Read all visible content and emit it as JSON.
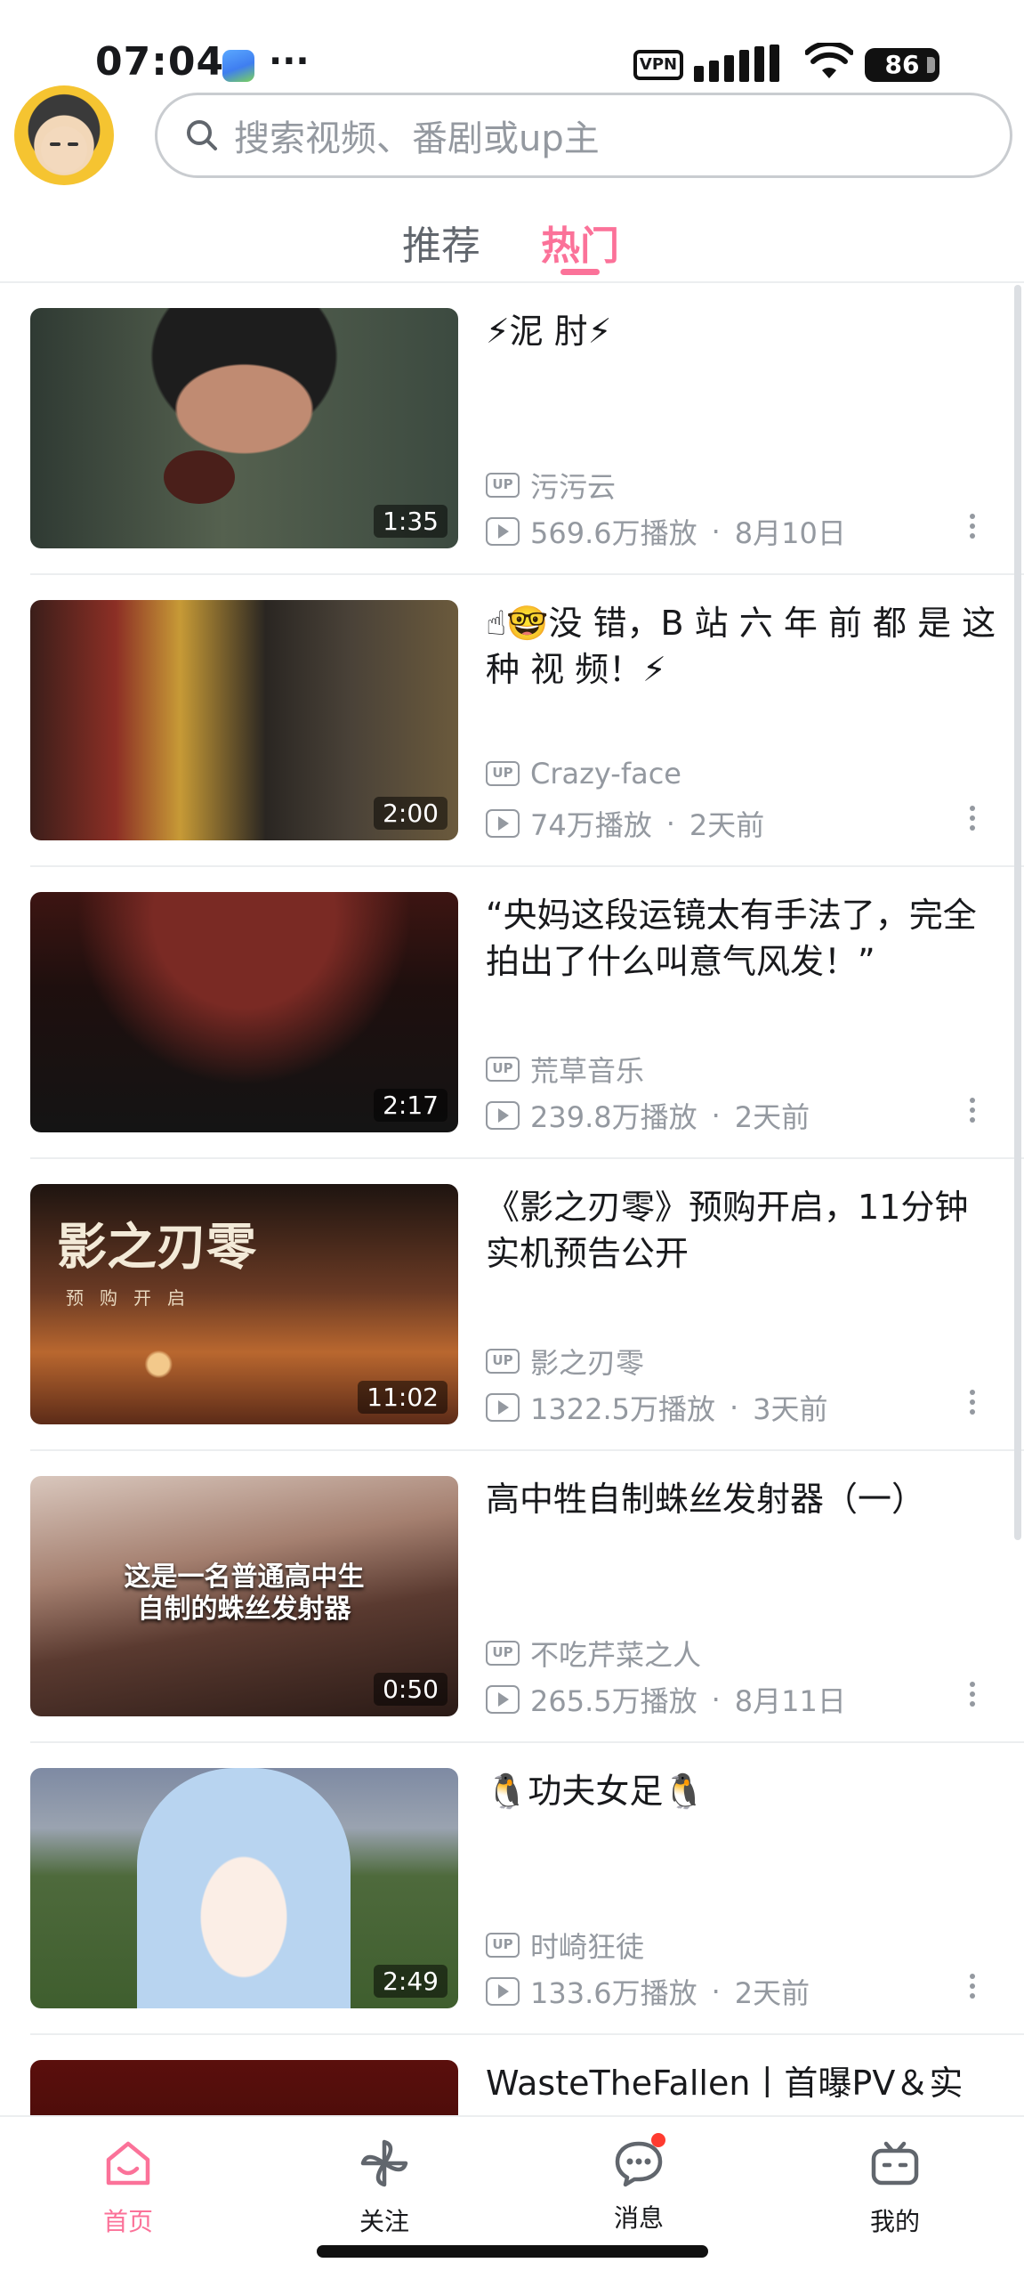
{
  "status_bar": {
    "time": "07:04",
    "dots": "···",
    "vpn": "VPN",
    "battery": "86"
  },
  "search": {
    "placeholder": "搜索视频、番剧或up主"
  },
  "tabs": [
    {
      "label": "推荐",
      "active": false
    },
    {
      "label": "热门",
      "active": true
    }
  ],
  "feed": [
    {
      "title": "⚡泥 肘⚡",
      "duration": "1:35",
      "up_badge": "UP",
      "uploader": "污污云",
      "plays": "569.6万播放",
      "date": "8月10日"
    },
    {
      "title": "☝🤓没 错，B 站 六 年 前 都 是 这 种 视 频！⚡",
      "duration": "2:00",
      "up_badge": "UP",
      "uploader": "Crazy-face",
      "plays": "74万播放",
      "date": "2天前"
    },
    {
      "title": "“央妈这段运镜太有手法了，完全拍出了什么叫意气风发！”",
      "duration": "2:17",
      "up_badge": "UP",
      "uploader": "荒草音乐",
      "plays": "239.8万播放",
      "date": "2天前"
    },
    {
      "title": "《影之刃零》预购开启，11分钟实机预告公开",
      "duration": "11:02",
      "up_badge": "UP",
      "uploader": "影之刃零",
      "plays": "1322.5万播放",
      "date": "3天前",
      "thumb_title": "影之刃零",
      "thumb_sub": "预购开启"
    },
    {
      "title": "高中牲自制蛛丝发射器（一）",
      "duration": "0:50",
      "up_badge": "UP",
      "uploader": "不吃芹菜之人",
      "plays": "265.5万播放",
      "date": "8月11日",
      "thumb_caption": "这是一名普通高中生\n自制的蛛丝发射器"
    },
    {
      "title": "🐧功夫女足🐧",
      "duration": "2:49",
      "up_badge": "UP",
      "uploader": "时崎狂徒",
      "plays": "133.6万播放",
      "date": "2天前"
    },
    {
      "title": "WasteTheFallen丨首曝PV＆实"
    }
  ],
  "separator": "·",
  "bottom_nav": [
    {
      "label": "首页",
      "icon": "home-icon",
      "active": true
    },
    {
      "label": "关注",
      "icon": "pinwheel-icon",
      "active": false
    },
    {
      "label": "消息",
      "icon": "chat-bubble-icon",
      "active": false,
      "badge_dot": true
    },
    {
      "label": "我的",
      "icon": "tv-icon",
      "active": false
    }
  ],
  "colors": {
    "accent": "#fb7299",
    "secondary_text": "#9499a0",
    "primary_text": "#18191c"
  }
}
